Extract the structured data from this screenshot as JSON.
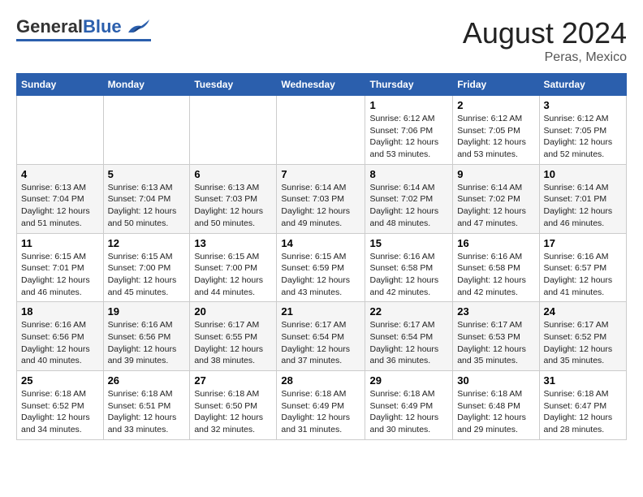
{
  "logo": {
    "general": "General",
    "blue": "Blue"
  },
  "title": "August 2024",
  "subtitle": "Peras, Mexico",
  "days_of_week": [
    "Sunday",
    "Monday",
    "Tuesday",
    "Wednesday",
    "Thursday",
    "Friday",
    "Saturday"
  ],
  "weeks": [
    [
      {
        "day": "",
        "content": ""
      },
      {
        "day": "",
        "content": ""
      },
      {
        "day": "",
        "content": ""
      },
      {
        "day": "",
        "content": ""
      },
      {
        "day": "1",
        "content": "Sunrise: 6:12 AM\nSunset: 7:06 PM\nDaylight: 12 hours\nand 53 minutes."
      },
      {
        "day": "2",
        "content": "Sunrise: 6:12 AM\nSunset: 7:05 PM\nDaylight: 12 hours\nand 53 minutes."
      },
      {
        "day": "3",
        "content": "Sunrise: 6:12 AM\nSunset: 7:05 PM\nDaylight: 12 hours\nand 52 minutes."
      }
    ],
    [
      {
        "day": "4",
        "content": "Sunrise: 6:13 AM\nSunset: 7:04 PM\nDaylight: 12 hours\nand 51 minutes."
      },
      {
        "day": "5",
        "content": "Sunrise: 6:13 AM\nSunset: 7:04 PM\nDaylight: 12 hours\nand 50 minutes."
      },
      {
        "day": "6",
        "content": "Sunrise: 6:13 AM\nSunset: 7:03 PM\nDaylight: 12 hours\nand 50 minutes."
      },
      {
        "day": "7",
        "content": "Sunrise: 6:14 AM\nSunset: 7:03 PM\nDaylight: 12 hours\nand 49 minutes."
      },
      {
        "day": "8",
        "content": "Sunrise: 6:14 AM\nSunset: 7:02 PM\nDaylight: 12 hours\nand 48 minutes."
      },
      {
        "day": "9",
        "content": "Sunrise: 6:14 AM\nSunset: 7:02 PM\nDaylight: 12 hours\nand 47 minutes."
      },
      {
        "day": "10",
        "content": "Sunrise: 6:14 AM\nSunset: 7:01 PM\nDaylight: 12 hours\nand 46 minutes."
      }
    ],
    [
      {
        "day": "11",
        "content": "Sunrise: 6:15 AM\nSunset: 7:01 PM\nDaylight: 12 hours\nand 46 minutes."
      },
      {
        "day": "12",
        "content": "Sunrise: 6:15 AM\nSunset: 7:00 PM\nDaylight: 12 hours\nand 45 minutes."
      },
      {
        "day": "13",
        "content": "Sunrise: 6:15 AM\nSunset: 7:00 PM\nDaylight: 12 hours\nand 44 minutes."
      },
      {
        "day": "14",
        "content": "Sunrise: 6:15 AM\nSunset: 6:59 PM\nDaylight: 12 hours\nand 43 minutes."
      },
      {
        "day": "15",
        "content": "Sunrise: 6:16 AM\nSunset: 6:58 PM\nDaylight: 12 hours\nand 42 minutes."
      },
      {
        "day": "16",
        "content": "Sunrise: 6:16 AM\nSunset: 6:58 PM\nDaylight: 12 hours\nand 42 minutes."
      },
      {
        "day": "17",
        "content": "Sunrise: 6:16 AM\nSunset: 6:57 PM\nDaylight: 12 hours\nand 41 minutes."
      }
    ],
    [
      {
        "day": "18",
        "content": "Sunrise: 6:16 AM\nSunset: 6:56 PM\nDaylight: 12 hours\nand 40 minutes."
      },
      {
        "day": "19",
        "content": "Sunrise: 6:16 AM\nSunset: 6:56 PM\nDaylight: 12 hours\nand 39 minutes."
      },
      {
        "day": "20",
        "content": "Sunrise: 6:17 AM\nSunset: 6:55 PM\nDaylight: 12 hours\nand 38 minutes."
      },
      {
        "day": "21",
        "content": "Sunrise: 6:17 AM\nSunset: 6:54 PM\nDaylight: 12 hours\nand 37 minutes."
      },
      {
        "day": "22",
        "content": "Sunrise: 6:17 AM\nSunset: 6:54 PM\nDaylight: 12 hours\nand 36 minutes."
      },
      {
        "day": "23",
        "content": "Sunrise: 6:17 AM\nSunset: 6:53 PM\nDaylight: 12 hours\nand 35 minutes."
      },
      {
        "day": "24",
        "content": "Sunrise: 6:17 AM\nSunset: 6:52 PM\nDaylight: 12 hours\nand 35 minutes."
      }
    ],
    [
      {
        "day": "25",
        "content": "Sunrise: 6:18 AM\nSunset: 6:52 PM\nDaylight: 12 hours\nand 34 minutes."
      },
      {
        "day": "26",
        "content": "Sunrise: 6:18 AM\nSunset: 6:51 PM\nDaylight: 12 hours\nand 33 minutes."
      },
      {
        "day": "27",
        "content": "Sunrise: 6:18 AM\nSunset: 6:50 PM\nDaylight: 12 hours\nand 32 minutes."
      },
      {
        "day": "28",
        "content": "Sunrise: 6:18 AM\nSunset: 6:49 PM\nDaylight: 12 hours\nand 31 minutes."
      },
      {
        "day": "29",
        "content": "Sunrise: 6:18 AM\nSunset: 6:49 PM\nDaylight: 12 hours\nand 30 minutes."
      },
      {
        "day": "30",
        "content": "Sunrise: 6:18 AM\nSunset: 6:48 PM\nDaylight: 12 hours\nand 29 minutes."
      },
      {
        "day": "31",
        "content": "Sunrise: 6:18 AM\nSunset: 6:47 PM\nDaylight: 12 hours\nand 28 minutes."
      }
    ]
  ]
}
